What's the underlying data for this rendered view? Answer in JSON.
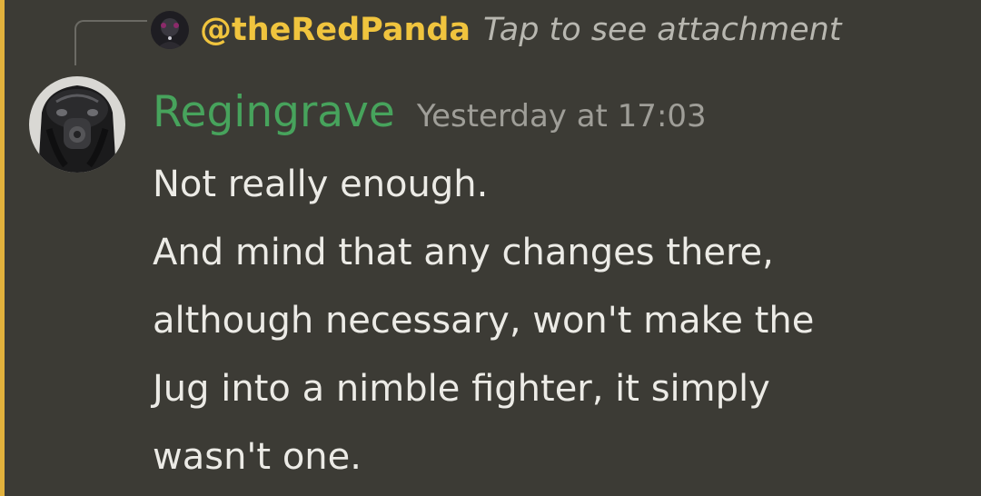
{
  "reply": {
    "username": "@theRedPanda",
    "attachment_text": "Tap to see attachment"
  },
  "message": {
    "author": "Regingrave",
    "timestamp": "Yesterday at 17:03",
    "lines": [
      "Not really enough.",
      "And mind that any changes there,",
      "although necessary, won't make the",
      "Jug into a nimble fighter, it simply",
      "wasn't one."
    ]
  },
  "colors": {
    "background": "#3c3b35",
    "mention_highlight": "#e2b13c",
    "reply_username": "#f0c43e",
    "author_name": "#47a35c"
  }
}
